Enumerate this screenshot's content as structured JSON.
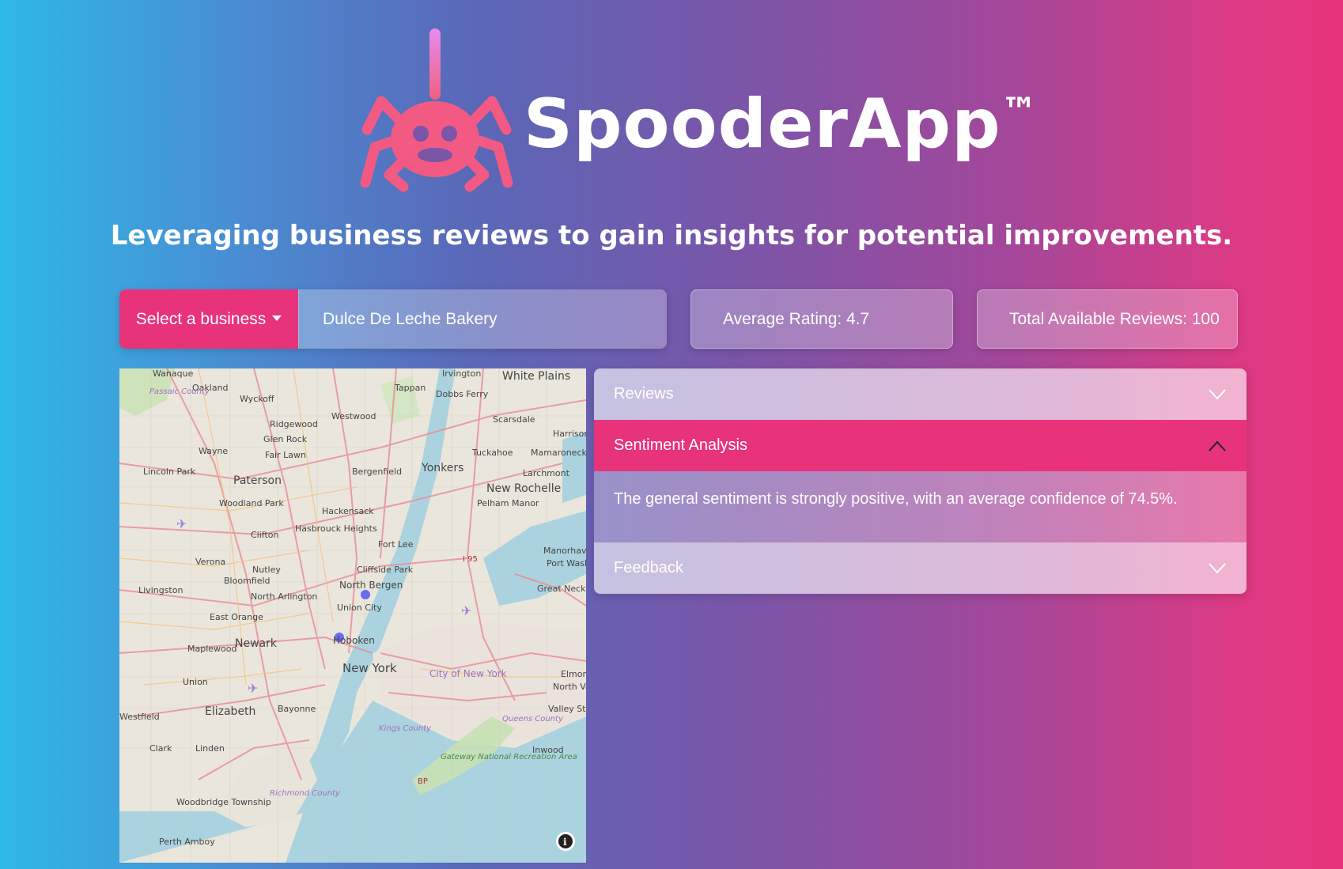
{
  "header": {
    "brand": "SpooderApp",
    "trademark": "™",
    "tagline": "Leveraging business reviews to gain insights for potential improvements.",
    "logo_icon": "spider-icon"
  },
  "controls": {
    "select_label": "Select a business",
    "selected_business": "Dulce De Leche Bakery",
    "average_rating": "Average Rating: 4.7",
    "total_reviews": "Total Available Reviews: 100"
  },
  "map": {
    "info_icon": "info-icon",
    "labels": [
      "Wanaque",
      "Oakland",
      "Passaic County",
      "Wyckoff",
      "Ridgewood",
      "Glen Rock",
      "Fair Lawn",
      "Wayne",
      "Lincoln Park",
      "Paterson",
      "Woodland Park",
      "Clifton",
      "Verona",
      "Nutley",
      "Bloomfield",
      "Livingston",
      "North Arlington",
      "East Orange",
      "Newark",
      "Maplewood",
      "Union",
      "Elizabeth",
      "Westfield",
      "Clark",
      "Linden",
      "Woodbridge Township",
      "Perth Amboy",
      "Richmond County",
      "Bayonne",
      "Hoboken",
      "Union City",
      "North Bergen",
      "Cliffside Park",
      "Fort Lee",
      "Hasbrouck Heights",
      "Hackensack",
      "Bergenfield",
      "Westwood",
      "Tappan",
      "Irvington",
      "Dobbs Ferry",
      "White Plains",
      "Scarsdale",
      "Harrison",
      "Tuckahoe",
      "Mamaroneck",
      "Yonkers",
      "Larchmont",
      "New Rochelle",
      "Pelham Manor",
      "Manorhaven",
      "Port Washington",
      "Great Neck",
      "I 95",
      "New York",
      "City of New York",
      "Kings County",
      "Queens County",
      "Valley Stream",
      "North Valley Stream",
      "Elmont",
      "Inwood",
      "Gateway National Recreation Area",
      "BP"
    ]
  },
  "accordion": {
    "items": [
      {
        "title": "Reviews",
        "state": "collapsed"
      },
      {
        "title": "Sentiment Analysis",
        "state": "expanded",
        "body": "The general sentiment is strongly positive, with an average confidence of 74.5%."
      },
      {
        "title": "Feedback",
        "state": "collapsed"
      }
    ]
  },
  "colors": {
    "accent": "#e8337a",
    "gradient_start": "#2eb8e6",
    "gradient_end": "#e8337a"
  }
}
